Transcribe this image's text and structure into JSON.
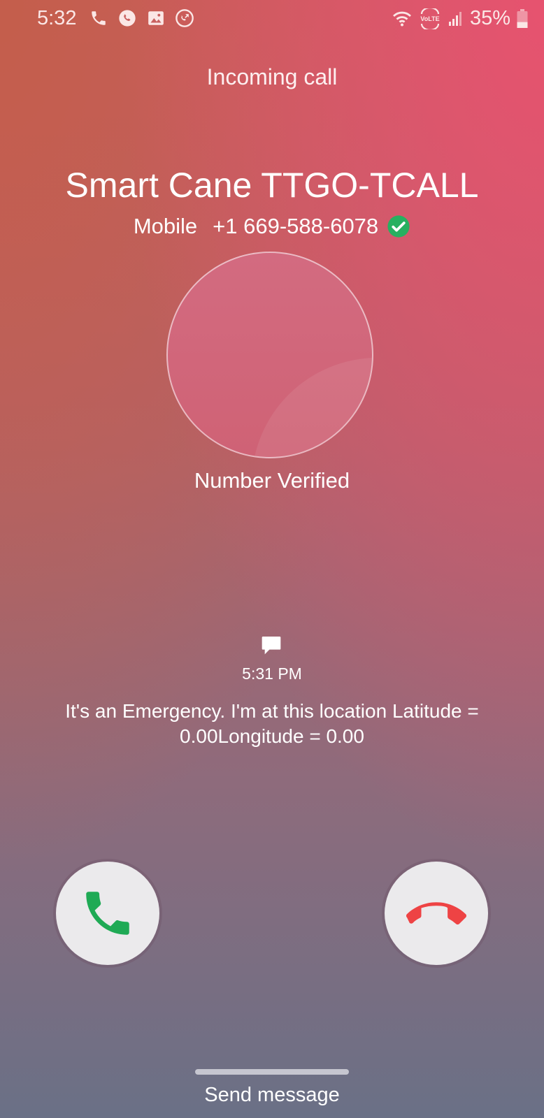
{
  "status_bar": {
    "time": "5:32",
    "left_icons": [
      "phone-icon",
      "whatsapp-icon",
      "gallery-icon",
      "call-forward-icon"
    ],
    "right_icons": [
      "wifi-icon",
      "volte-icon",
      "signal-icon",
      "battery-icon"
    ],
    "volte_label": "VoLTE",
    "battery_percent": "35%",
    "battery_level": 0.35
  },
  "call": {
    "state": "Incoming call",
    "caller_name": "Smart Cane TTGO-TCALL",
    "number_type": "Mobile",
    "number": "+1 669-588-6078",
    "verified_label": "Number Verified"
  },
  "message": {
    "time": "5:31 PM",
    "text": "It's an Emergency. I'm at this location Latitude = 0.00Longitude = 0.00"
  },
  "actions": {
    "accept_color": "#1faa55",
    "decline_color": "#ee4344",
    "send_message_label": "Send message"
  },
  "colors": {
    "verified_badge": "#27b060"
  }
}
